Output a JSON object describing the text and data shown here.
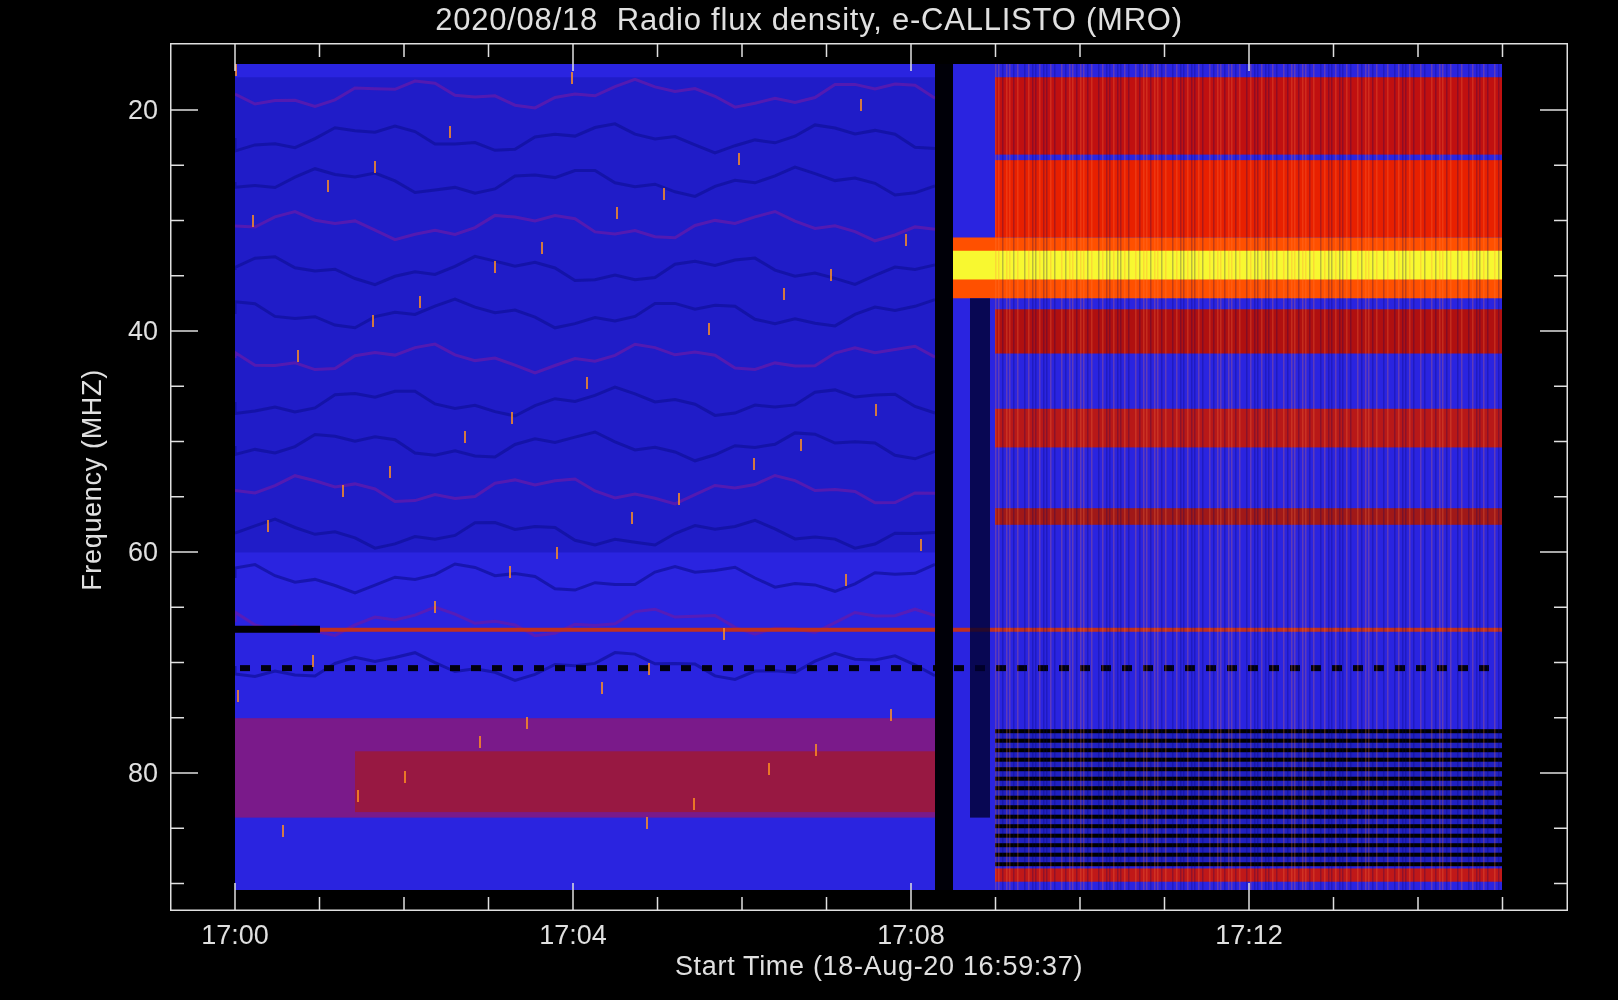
{
  "title": "2020/08/18  Radio flux density, e-CALLISTO (MRO)",
  "y_axis": {
    "label": "Frequency (MHZ)",
    "ticks": [
      "20",
      "40",
      "60",
      "80"
    ]
  },
  "x_axis": {
    "label": "Start Time (18-Aug-20 16:59:37)",
    "ticks": [
      "17:00",
      "17:04",
      "17:08",
      "17:12"
    ]
  }
}
